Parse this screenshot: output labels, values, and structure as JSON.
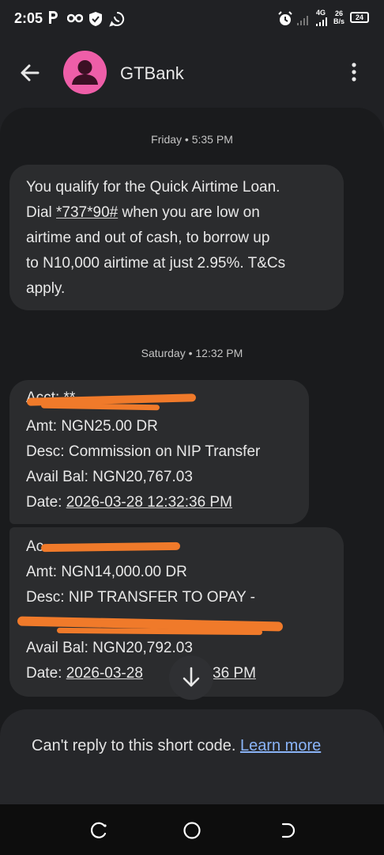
{
  "status_bar": {
    "time": "2:05",
    "network_type": "4G",
    "net_speed_value": "26",
    "net_speed_unit": "B/s",
    "battery_level": "24",
    "icons": [
      "parking-icon",
      "link-icon",
      "shield-icon",
      "whatsapp-icon",
      "alarm-icon",
      "wifi-icon",
      "signal-icon"
    ]
  },
  "header": {
    "contact_name": "GTBank",
    "avatar_color": "#ee5ea8",
    "icons": [
      "back-arrow-icon",
      "person-icon",
      "more-vert-icon"
    ]
  },
  "thread": {
    "groups": [
      {
        "timestamp": "Friday • 5:35 PM",
        "message": {
          "lines": [
            "You qualify for the Quick Airtime Loan.",
            "when you are low on",
            "airtime and out of cash, to borrow up",
            "to N10,000 airtime at just 2.95%. T&Cs",
            "apply."
          ],
          "dial_prefix": "Dial",
          "dial_code": "*737*90#"
        }
      },
      {
        "timestamp": "Saturday • 12:32 PM",
        "messages": [
          {
            "acct_visible": "Acct: **",
            "amt": "Amt: NGN25.00 DR",
            "desc": "Desc: Commission on NIP Transfer",
            "avail_bal": "Avail Bal: NGN20,767.03",
            "date_label": "Date:",
            "date_value": "2026-03-28 12:32:36 PM"
          },
          {
            "acct_visible": "Ac",
            "amt": "Amt: NGN14,000.00 DR",
            "desc": "Desc: NIP TRANSFER TO OPAY -",
            "avail_bal": "Avail Bal: NGN20,792.03",
            "date_label": "Date:",
            "date_value_start": "2026-03-28",
            "date_value_end": "36 PM"
          }
        ]
      }
    ],
    "redaction_color": "#f07a2a"
  },
  "reply_bar": {
    "text": "Can't reply to this short code.",
    "link_text": "Learn more"
  },
  "nav_bar": {
    "icons": [
      "recents-icon",
      "home-icon",
      "back-icon"
    ]
  }
}
